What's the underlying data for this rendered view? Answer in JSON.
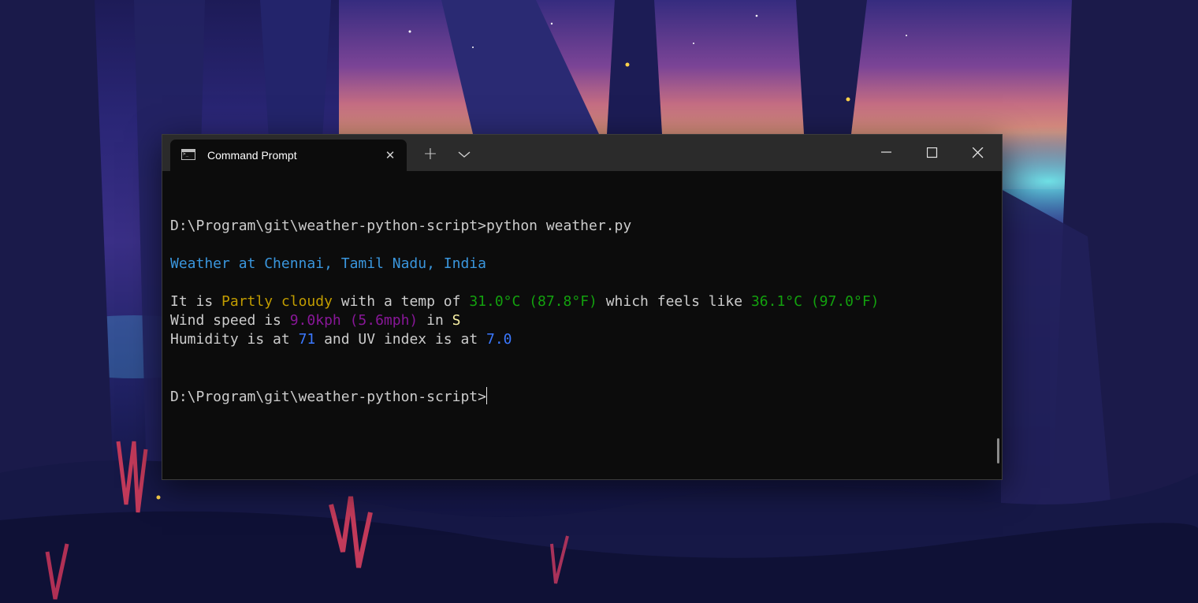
{
  "window": {
    "tab_title": "Command Prompt",
    "tab_icon": "terminal-icon"
  },
  "terminal": {
    "command_line": {
      "prompt": "D:\\Program\\git\\weather-python-script>",
      "command": "python weather.py"
    },
    "heading": "Weather at Chennai, Tamil Nadu, India",
    "line1": {
      "t1": "It is ",
      "condition": "Partly cloudy",
      "t2": " with a temp of ",
      "temp": "31.0°C (87.8°F)",
      "t3": " which feels like ",
      "feels_like": "36.1°C (97.0°F)"
    },
    "line2": {
      "t1": "Wind speed is ",
      "wind": "9.0kph (5.6mph)",
      "t2": " in ",
      "direction": "S"
    },
    "line3": {
      "t1": "Humidity is at ",
      "humidity": "71",
      "t2": " and UV index is at ",
      "uv": "7.0"
    },
    "final_prompt": "D:\\Program\\git\\weather-python-script>"
  },
  "colors": {
    "blue": "#3a96dd",
    "yellow": "#c19c00",
    "green": "#13a10e",
    "purple": "#881798",
    "light_yellow": "#f9f1a5",
    "light_blue": "#3b78ff"
  }
}
